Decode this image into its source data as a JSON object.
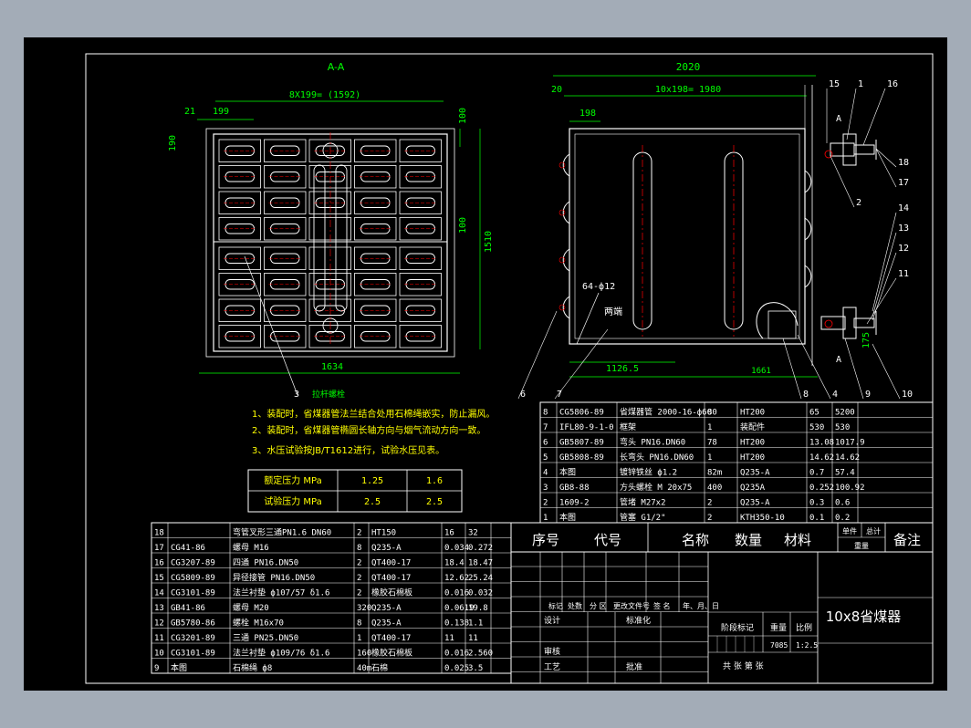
{
  "colors": {
    "sheet": "#000000",
    "border": "#ffffff",
    "dimension": "#00ff00",
    "centerline": "#ff0000",
    "notes": "#ffff00",
    "outer": "#a3acb7"
  },
  "section_view": {
    "label": "A-A",
    "dim_top": "8X199= (1592)",
    "dim_21": "21",
    "dim_199": "199",
    "dim_190": "190",
    "dim_100a": "100",
    "dim_100b": "100",
    "dim_1510": "1510",
    "dim_1634": "1634",
    "dim_3": "3",
    "label_mid": "拉杆螺栓"
  },
  "side_view": {
    "dim_2020": "2020",
    "dim_20": "20",
    "dim_mid": "10x198= 1980",
    "dim_198": "198",
    "dim_1126": "1126.5",
    "dim_1661": "1661",
    "dim_175": "175",
    "label_holes": "64-ф12",
    "label_ends": "两端",
    "label_A1": "A",
    "label_A2": "A",
    "balloons": [
      "15",
      "1",
      "16",
      "18",
      "17",
      "14",
      "13",
      "12",
      "11",
      "2",
      "6",
      "7",
      "8",
      "4",
      "9",
      "10"
    ]
  },
  "notes": [
    "1、装配时，省煤器管法兰结合处用石棉绳嵌实，防止漏风。",
    "2、装配时，省煤器管椭圆长轴方向与烟气流动方向一致。",
    "3、水压试验按JB/T1612进行，试验水压见表。"
  ],
  "pressure_table": [
    [
      "额定压力 MPa",
      "1.25",
      "1.6"
    ],
    [
      "试验压力 MPa",
      "2.5",
      "2.5"
    ]
  ],
  "bom_upper": [
    [
      "8",
      "CG5806-89",
      "省煤器管 2000-16-ф60",
      "80",
      "HT200",
      "65",
      "5200"
    ],
    [
      "7",
      "IFL80-9-1-0",
      "框架",
      "1",
      "装配件",
      "530",
      "530"
    ],
    [
      "6",
      "GB5807-89",
      "弯头 PN16.DN60",
      "78",
      "HT200",
      "13.08",
      "1017.9"
    ],
    [
      "5",
      "GB5808-89",
      "长弯头 PN16.DN60",
      "1",
      "HT200",
      "14.62",
      "14.62"
    ],
    [
      "4",
      "本图",
      "镀锌铁丝 ф1.2",
      "82m",
      "Q235-A",
      "0.7",
      "57.4"
    ],
    [
      "3",
      "GB8-88",
      "方头螺栓 M 20x75",
      "400",
      "Q235A",
      "0.252",
      "100.92"
    ],
    [
      "2",
      "1609-2",
      "管堵 M27x2",
      "2",
      "Q235-A",
      "0.3",
      "0.6"
    ],
    [
      "1",
      "本图",
      "管塞 G1/2\"",
      "2",
      "KTH350-10",
      "0.1",
      "0.2"
    ]
  ],
  "bom_header": {
    "no": "序号",
    "code": "代号",
    "name": "名称",
    "qty": "数量",
    "material": "材料",
    "unit_wt": "单件",
    "total_wt": "总计",
    "weight": "重量",
    "remark": "备注"
  },
  "bom_lower": [
    [
      "18",
      "",
      "弯管叉形三通PN1.6 DN60",
      "2",
      "HT150",
      "16",
      "32"
    ],
    [
      "17",
      "CG41-86",
      "螺母 M16",
      "8",
      "Q235-A",
      "0.034",
      "0.272"
    ],
    [
      "16",
      "CG3207-89",
      "四通 PN16.DN50",
      "2",
      "QT400-17",
      "18.4",
      "18.47"
    ],
    [
      "15",
      "CG5809-89",
      "异径接管 PN16.DN50",
      "2",
      "QT400-17",
      "12.62",
      "25.24"
    ],
    [
      "14",
      "CG3101-89",
      "法兰衬垫 ф107/57 δ1.6",
      "2",
      "橡胶石棉板",
      "0.016",
      "0.032"
    ],
    [
      "13",
      "GB41-86",
      "螺母 M20",
      "320",
      "Q235-A",
      "0.0619",
      "19.8"
    ],
    [
      "12",
      "GB5780-86",
      "螺栓 M16x70",
      "8",
      "Q235-A",
      "0.138",
      "1.1"
    ],
    [
      "11",
      "CG3201-89",
      "三通 PN25.DN50",
      "1",
      "QT400-17",
      "11",
      "11"
    ],
    [
      "10",
      "CG3101-89",
      "法兰衬垫 ф109/76 δ1.6",
      "160",
      "橡胶石棉板",
      "0.016",
      "2.560"
    ],
    [
      "9",
      "本图",
      "石棉绳 ф8",
      "40m",
      "石棉",
      "0.025",
      "3.5"
    ]
  ],
  "title_block": {
    "title": "10x8省煤器",
    "row1": [
      "标记",
      "处数",
      "分 区",
      "更改文件号",
      "签 名",
      "年、月、日"
    ],
    "design": "设计",
    "std": "标准化",
    "stage": "阶段标记",
    "weight": "重量",
    "scale": "比例",
    "weight_val": "7085",
    "scale_val": "1:2.5",
    "check": "审核",
    "process": "工艺",
    "approve": "批准",
    "sheets": "共   张   第   张"
  }
}
